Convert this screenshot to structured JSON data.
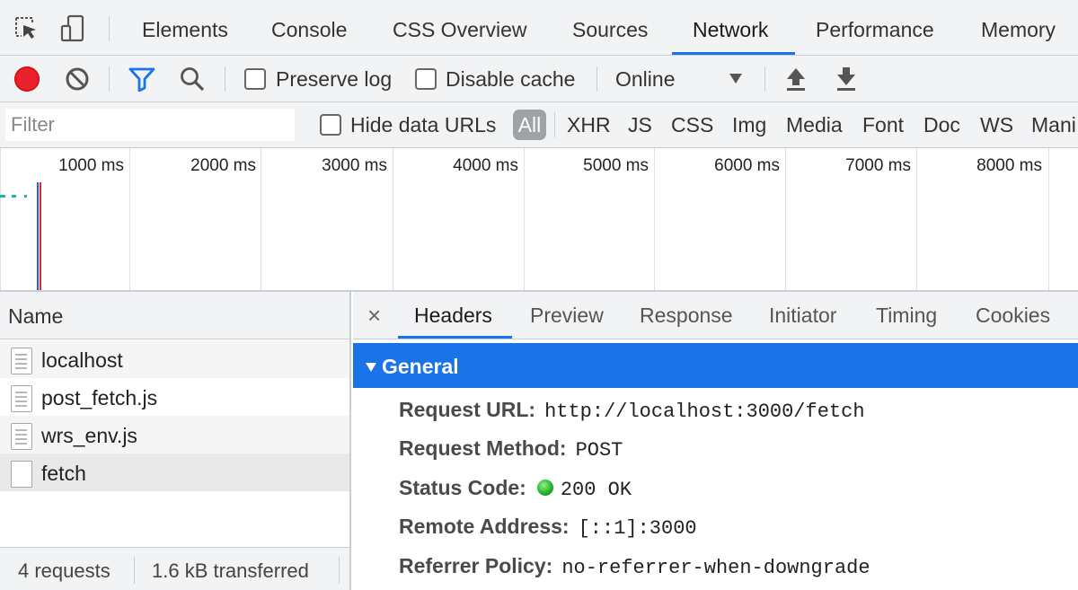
{
  "main_tabs": [
    "Elements",
    "Console",
    "CSS Overview",
    "Sources",
    "Network",
    "Performance",
    "Memory"
  ],
  "active_tab": "Network",
  "toolbar": {
    "preserve_log": "Preserve log",
    "disable_cache": "Disable cache",
    "throttling": "Online"
  },
  "filter": {
    "placeholder": "Filter",
    "hide_data_urls": "Hide data URLs",
    "types": [
      "All",
      "XHR",
      "JS",
      "CSS",
      "Img",
      "Media",
      "Font",
      "Doc",
      "WS",
      "Mani"
    ]
  },
  "overview_ticks": [
    "1000 ms",
    "2000 ms",
    "3000 ms",
    "4000 ms",
    "5000 ms",
    "6000 ms",
    "7000 ms",
    "8000 ms"
  ],
  "requests": {
    "column_header": "Name",
    "items": [
      "localhost",
      "post_fetch.js",
      "wrs_env.js",
      "fetch"
    ],
    "summary_count": "4 requests",
    "summary_transferred": "1.6 kB transferred"
  },
  "details": {
    "close": "×",
    "tabs": [
      "Headers",
      "Preview",
      "Response",
      "Initiator",
      "Timing",
      "Cookies"
    ],
    "active_tab": "Headers",
    "section": "General",
    "headers": [
      {
        "key": "Request URL:",
        "value": "http://localhost:3000/fetch"
      },
      {
        "key": "Request Method:",
        "value": "POST"
      },
      {
        "key": "Status Code:",
        "value": "200 OK"
      },
      {
        "key": "Remote Address:",
        "value": "[::1]:3000"
      },
      {
        "key": "Referrer Policy:",
        "value": "no-referrer-when-downgrade"
      }
    ]
  },
  "colors": {
    "accent": "#1a73e8",
    "record": "#e8232c",
    "status_ok": "#1eae2a"
  },
  "icons": [
    "inspect-element-icon",
    "device-toolbar-icon",
    "record-icon",
    "clear-icon",
    "filter-icon",
    "search-icon",
    "import-har-icon",
    "export-har-icon",
    "chevron-down-icon",
    "document-icon",
    "close-icon"
  ]
}
